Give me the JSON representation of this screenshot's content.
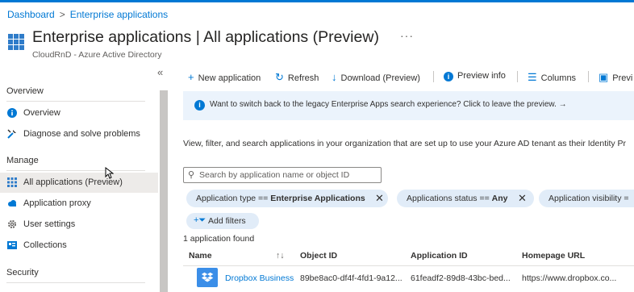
{
  "breadcrumb": {
    "home": "Dashboard",
    "separator": ">",
    "current": "Enterprise applications"
  },
  "header": {
    "title": "Enterprise applications | All applications (Preview)",
    "more": "···",
    "subtitle": "CloudRnD - Azure Active Directory"
  },
  "sidebar": {
    "collapse": "«",
    "sections": [
      {
        "title": "Overview"
      },
      {
        "title": "Manage"
      },
      {
        "title": "Security"
      }
    ],
    "items": [
      {
        "label": "Overview",
        "icon": "info-icon",
        "color": "#0078d4"
      },
      {
        "label": "Diagnose and solve problems",
        "icon": "wrench-icon",
        "color": "#0078d4"
      },
      {
        "label": "All applications (Preview)",
        "icon": "grid-icon",
        "color": "#2f7cc9",
        "selected": true
      },
      {
        "label": "Application proxy",
        "icon": "cloud-icon",
        "color": "#0078d4"
      },
      {
        "label": "User settings",
        "icon": "gear-icon",
        "color": "#605e5c"
      },
      {
        "label": "Collections",
        "icon": "collections-icon",
        "color": "#0078d4"
      }
    ]
  },
  "toolbar": {
    "new_application": "New application",
    "refresh": "Refresh",
    "download": "Download (Preview)",
    "preview_info": "Preview info",
    "columns": "Columns",
    "preview_features": "Previ"
  },
  "banner": {
    "text": "Want to switch back to the legacy Enterprise Apps search experience? Click to leave the preview.",
    "arrow": "→"
  },
  "description": "View, filter, and search applications in your organization that are set up to use your Azure AD tenant as their Identity Pr",
  "search": {
    "placeholder": "Search by application name or object ID",
    "value": ""
  },
  "filters": [
    {
      "label": "Application type == ",
      "value": "Enterprise Applications"
    },
    {
      "label": "Applications status == ",
      "value": "Any"
    },
    {
      "label": "Application visibility =",
      "value": ""
    }
  ],
  "add_filters": "Add filters",
  "count_text": "1 application found",
  "table": {
    "columns": [
      "Name",
      "Object ID",
      "Application ID",
      "Homepage URL"
    ],
    "sort_icon": "↑↓",
    "rows": [
      {
        "name": "Dropbox Business",
        "object_id": "89be8ac0-df4f-4fd1-9a12...",
        "app_id": "61feadf2-89d8-43bc-bed...",
        "homepage": "https://www.dropbox.co...",
        "icon": "dropbox-icon"
      }
    ]
  },
  "colors": {
    "accent": "#0078d4",
    "selected_bg": "#edebe9",
    "banner_bg": "#ebf3fc",
    "pill_bg": "#e1ecf8"
  }
}
